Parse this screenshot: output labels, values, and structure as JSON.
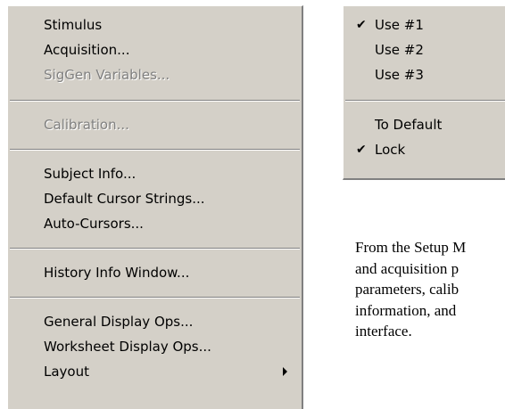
{
  "setup_menu": {
    "items": [
      {
        "label": "Stimulus",
        "enabled": true
      },
      {
        "label": "Acquisition...",
        "enabled": true
      },
      {
        "label": "SigGen Variables...",
        "enabled": false
      },
      {
        "label": "Calibration...",
        "enabled": false
      },
      {
        "label": "Subject Info...",
        "enabled": true
      },
      {
        "label": "Default Cursor Strings...",
        "enabled": true
      },
      {
        "label": "Auto-Cursors...",
        "enabled": true
      },
      {
        "label": "History Info Window...",
        "enabled": true
      },
      {
        "label": "General Display Ops...",
        "enabled": true
      },
      {
        "label": "Worksheet Display Ops...",
        "enabled": true
      },
      {
        "label": "Layout",
        "enabled": true,
        "has_submenu": true
      }
    ]
  },
  "use_menu": {
    "items": [
      {
        "label": "Use #1",
        "checked": true
      },
      {
        "label": "Use #2",
        "checked": false
      },
      {
        "label": "Use #3",
        "checked": false
      },
      {
        "label": "To Default",
        "checked": false
      },
      {
        "label": "Lock",
        "checked": true
      }
    ],
    "check_glyph": "✔"
  },
  "description": {
    "lines": [
      "From the Setup M",
      "and acquisition p",
      "parameters, calib",
      "information, and",
      "interface."
    ]
  },
  "colors": {
    "menu_background": "#d4d0c8",
    "disabled_text": "#808080",
    "page_background": "#ffffff"
  }
}
